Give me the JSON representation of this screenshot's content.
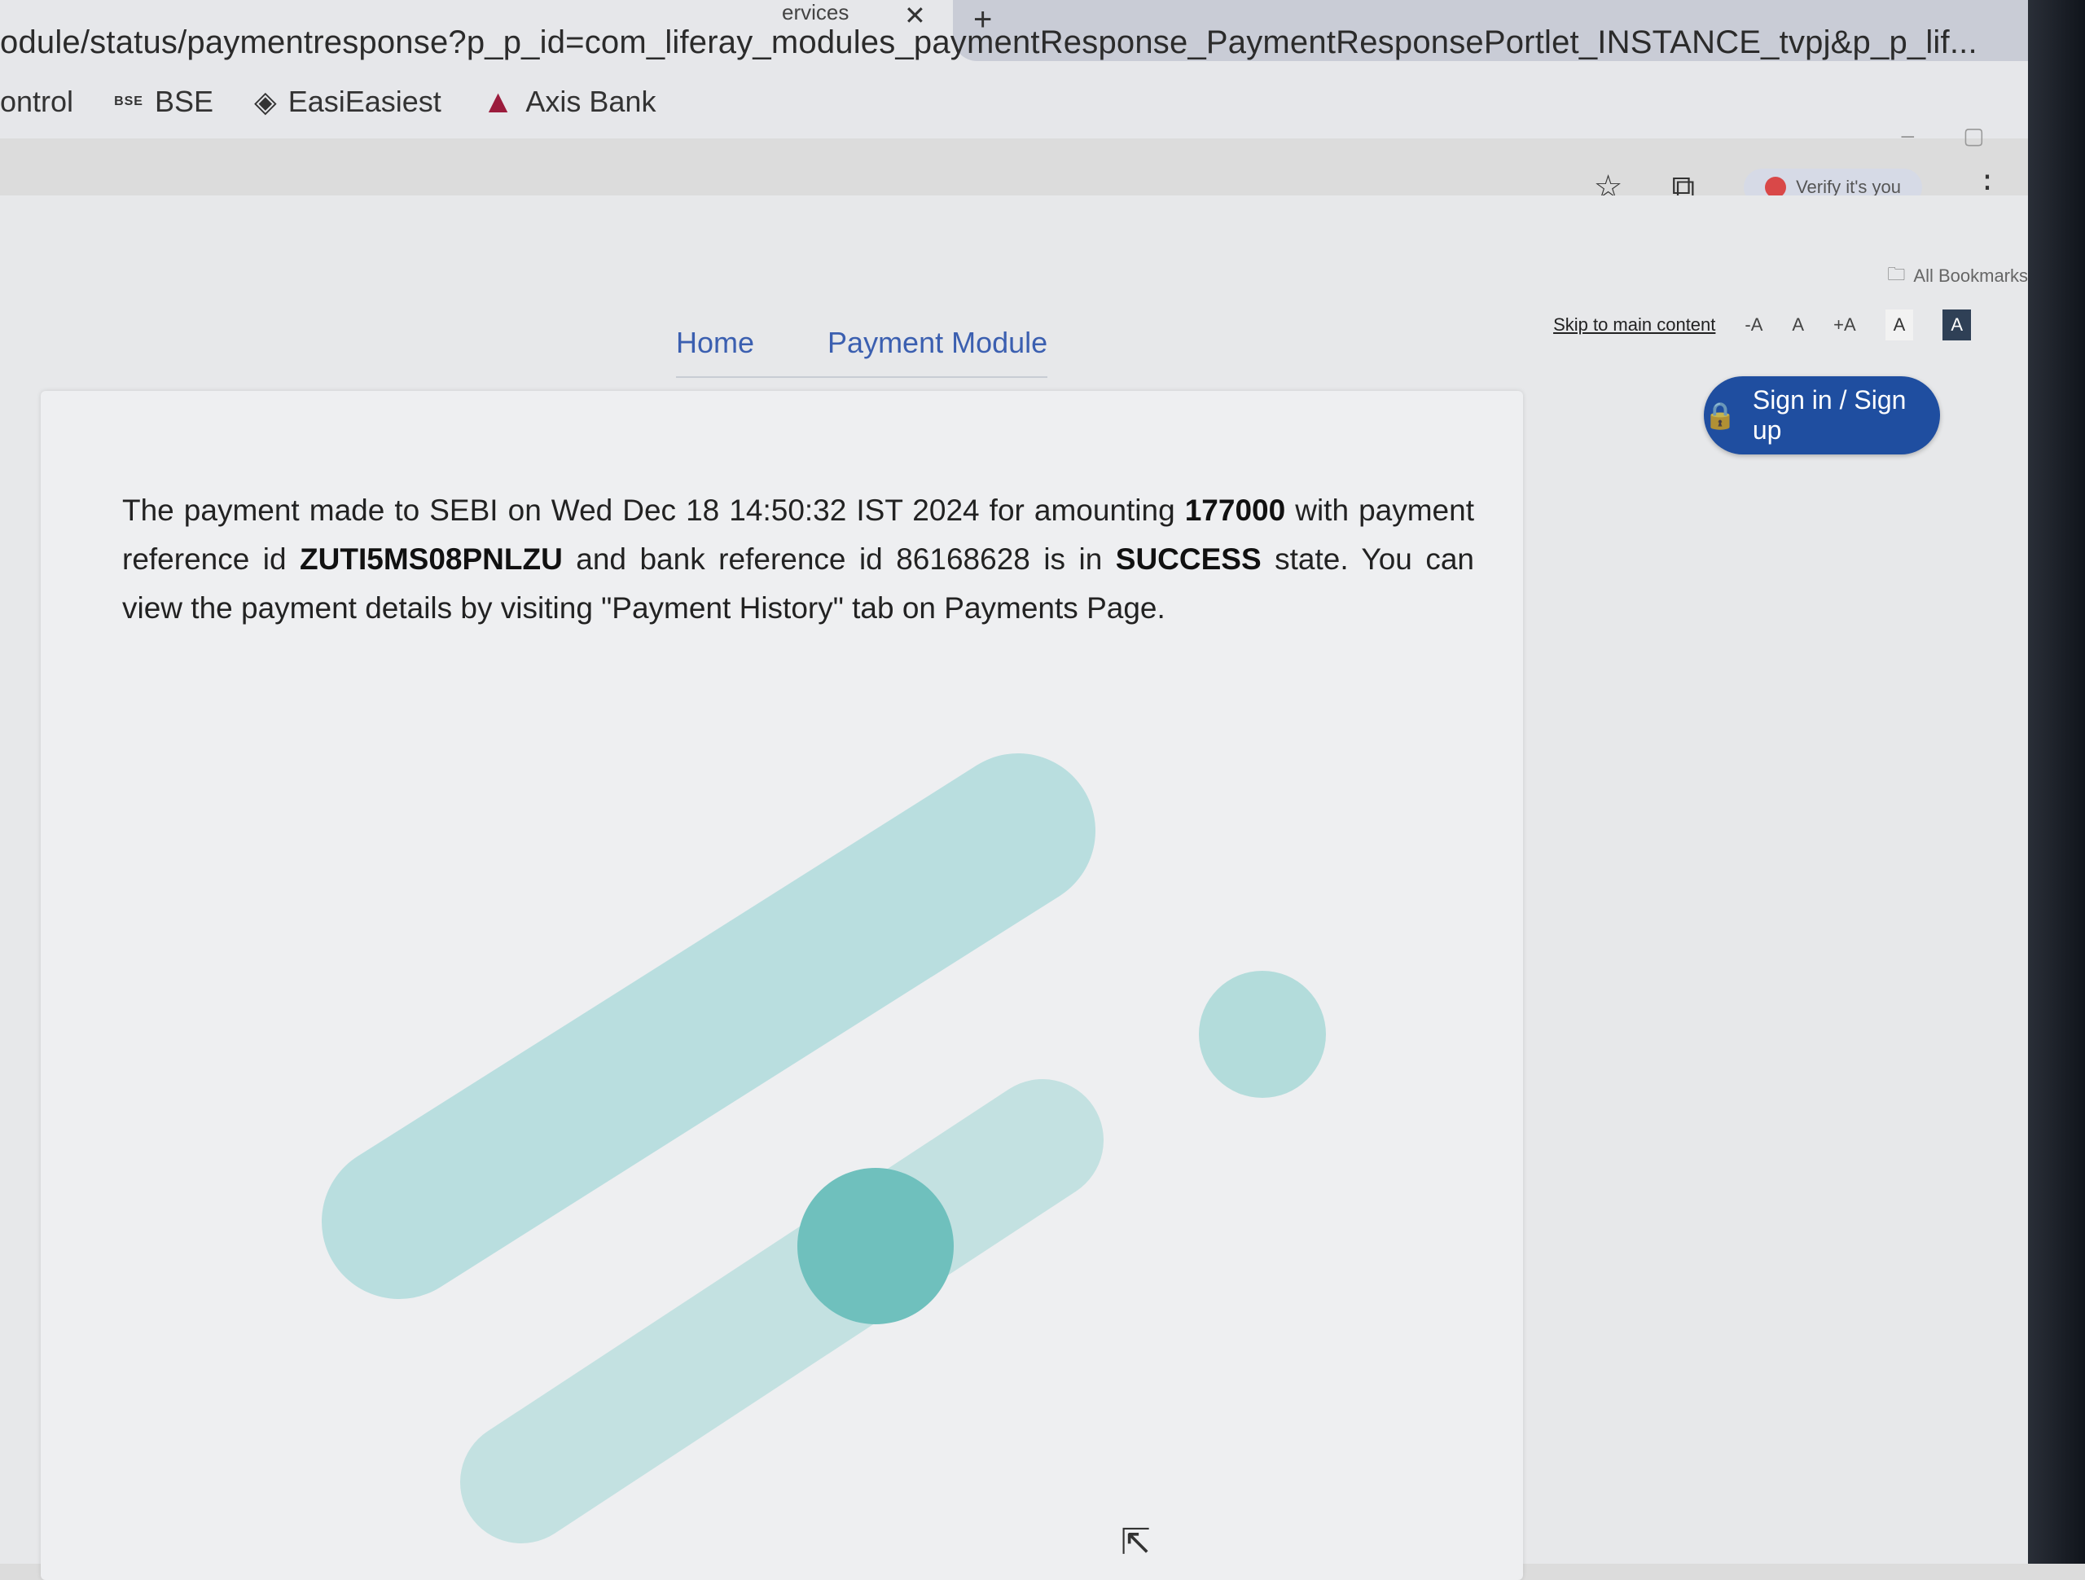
{
  "browser": {
    "tab_fragment": "ervices",
    "url": "odule/status/paymentresponse?p_p_id=com_liferay_modules_paymentResponse_PaymentResponsePortlet_INSTANCE_tvpj&p_p_lif...",
    "bookmarks": [
      "ontrol",
      "BSE",
      "EasiEasiest",
      "Axis Bank"
    ],
    "bse_icon_text": "BSE",
    "verify_label": "Verify it's you",
    "all_bookmarks_label": "All Bookmarks"
  },
  "accessibility": {
    "skip_label": "Skip to main content",
    "font_decrease": "-A",
    "font_normal": "A",
    "font_increase": "+A",
    "contrast_light": "A",
    "contrast_dark": "A"
  },
  "nav": {
    "home": "Home",
    "payment_module": "Payment Module"
  },
  "signin": {
    "label": "Sign in / Sign up"
  },
  "payment": {
    "p1": "The payment made to SEBI on Wed Dec 18 14:50:32 IST 2024 for amounting ",
    "amount": "177000",
    "p2": " with payment reference id ",
    "reference_id": "ZUTI5MS08PNLZU",
    "p3": " and bank reference id 86168628 is in ",
    "state": "SUCCESS",
    "p4": " state. You can view the payment details by visiting \"Payment History\" tab on Payments Page."
  },
  "colors": {
    "accent_blue": "#1f4ea0",
    "link_blue": "#3b5fb0",
    "deco_teal": "#9fd3d3"
  }
}
